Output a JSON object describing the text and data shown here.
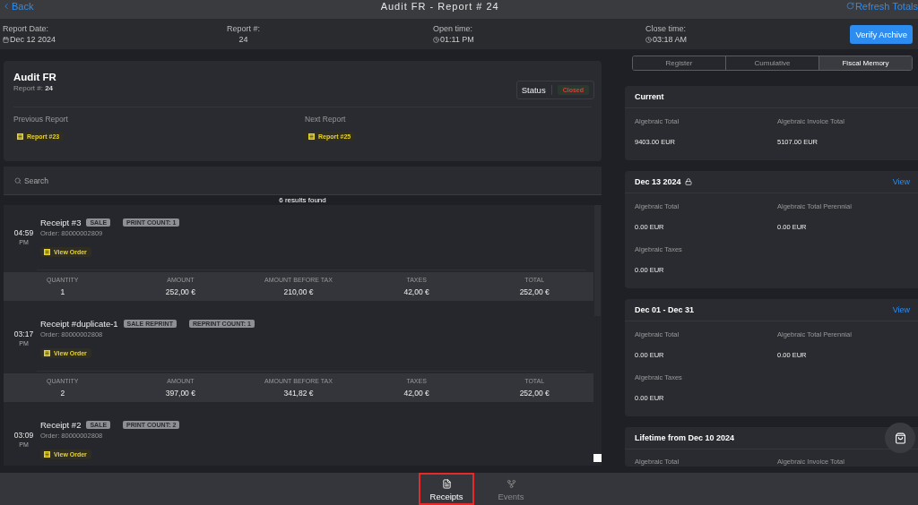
{
  "nav": {
    "back": "Back",
    "title": "Audit FR - Report # 24",
    "refresh": "Refresh Totals"
  },
  "info": [
    {
      "label": "Report Date:",
      "value": "Dec 12 2024",
      "kind": "date"
    },
    {
      "label": "Report #:",
      "value": "24",
      "kind": "number"
    },
    {
      "label": "Open time:",
      "value": "01:11 PM",
      "kind": "time"
    },
    {
      "label": "Close time:",
      "value": "03:18 AM",
      "kind": "time"
    }
  ],
  "verify_button": "Verify Archive",
  "report": {
    "title": "Audit FR",
    "number": "Report #: **24**",
    "status_label": "Status",
    "status": "Closed",
    "links": [
      {
        "label": "Previous Report",
        "link": "Report #23"
      },
      {
        "label": "Next Report",
        "link": "Report #25"
      }
    ]
  },
  "search": {
    "placeholder": "Search"
  },
  "results": "6 results found",
  "receipts": [
    {
      "time": "04:59",
      "period": "PM",
      "title": "Receipt #3",
      "tags": [
        "SALE",
        "PRINT COUNT: 1"
      ],
      "order": "Order: 80000002809",
      "action": "View Order",
      "stats": [
        {
          "label": "QUANTITY",
          "value": "1"
        },
        {
          "label": "AMOUNT",
          "value": "252,00 €"
        },
        {
          "label": "AMOUNT BEFORE TAX",
          "value": "210,00 €"
        },
        {
          "label": "TAXES",
          "value": "42,00 €"
        },
        {
          "label": "TOTAL",
          "value": "252,00 €"
        }
      ]
    },
    {
      "time": "03:17",
      "period": "PM",
      "title": "Receipt #duplicate-1",
      "tags": [
        "SALE REPRINT",
        "REPRINT COUNT: 1"
      ],
      "order": "Order: 80000002808",
      "action": "View Order",
      "stats": [
        {
          "label": "QUANTITY",
          "value": "2"
        },
        {
          "label": "AMOUNT",
          "value": "397,00 €"
        },
        {
          "label": "AMOUNT BEFORE TAX",
          "value": "341,82 €"
        },
        {
          "label": "TAXES",
          "value": "42,00 €"
        },
        {
          "label": "TOTAL",
          "value": "252,00 €"
        }
      ]
    },
    {
      "time": "03:09",
      "period": "PM",
      "title": "Receipt #2",
      "tags": [
        "SALE",
        "PRINT COUNT: 2"
      ],
      "order": "Order: 80000002808",
      "action": "View Order"
    }
  ],
  "fiscal_tabs": [
    {
      "label": "Register",
      "selected": false
    },
    {
      "label": "Cumulative",
      "selected": false
    },
    {
      "label": "Fiscal Memory",
      "selected": true
    }
  ],
  "cards": [
    {
      "title": "Current",
      "locked": false,
      "fields": [
        {
          "label": "Algebraic Total",
          "value": "9403.00 EUR"
        },
        {
          "label": "Algebraic Invoice Total",
          "value": "5107.00 EUR"
        }
      ]
    },
    {
      "title": "Dec 13 2024",
      "locked": true,
      "action": "View",
      "fields": [
        {
          "label": "Algebraic Total",
          "value": "0.00 EUR"
        },
        {
          "label": "Algebraic Total Perennial",
          "value": "0.00 EUR"
        },
        {
          "label": "Algebraic Taxes",
          "value": "0.00 EUR"
        }
      ]
    },
    {
      "title": "Dec 01 - Dec 31",
      "locked": false,
      "action": "View",
      "fields": [
        {
          "label": "Algebraic Total",
          "value": "0.00 EUR"
        },
        {
          "label": "Algebraic Total Perennial",
          "value": "0.00 EUR"
        },
        {
          "label": "Algebraic Taxes",
          "value": "0.00 EUR"
        }
      ]
    },
    {
      "title": "Lifetime from Dec 10 2024",
      "locked": false,
      "fields": [
        {
          "label": "Algebraic Total"
        },
        {
          "label": "Algebraic Invoice Total"
        }
      ]
    }
  ],
  "bottom_tabs": [
    {
      "label": "Receipts",
      "kind": "receipts",
      "selected": true
    },
    {
      "label": "Events",
      "kind": "events",
      "selected": false
    }
  ]
}
